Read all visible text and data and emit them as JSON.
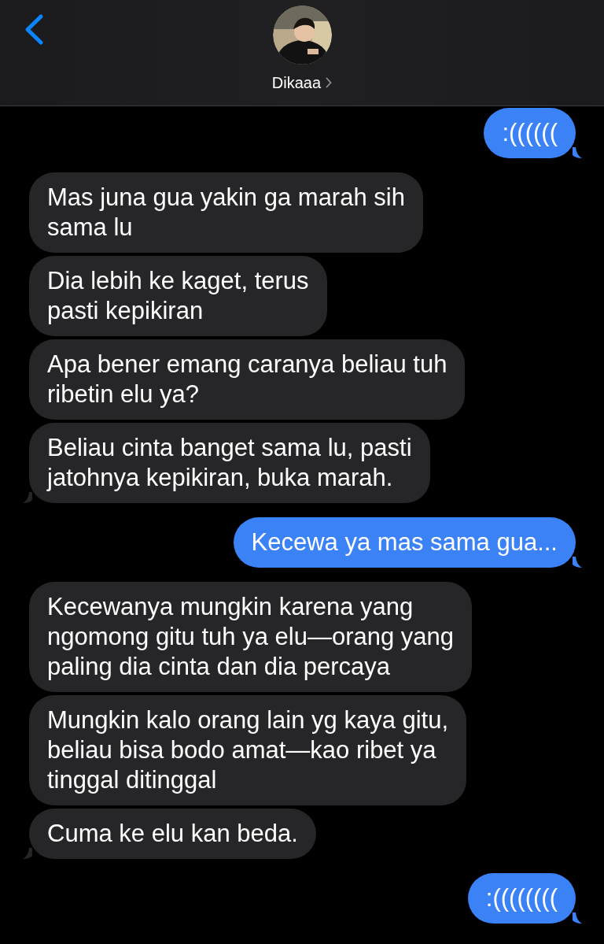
{
  "header": {
    "contact_name": "Dikaaa"
  },
  "messages": [
    {
      "kind": "sent",
      "text": ":((((((",
      "tail": true
    },
    {
      "kind": "received",
      "text": "Mas juna gua yakin ga marah sih\nsama lu",
      "tail": false
    },
    {
      "kind": "received",
      "text": "Dia lebih ke kaget, terus\npasti kepikiran",
      "tail": false
    },
    {
      "kind": "received",
      "text": "Apa bener emang caranya beliau tuh\nribetin elu ya?",
      "tail": false
    },
    {
      "kind": "received",
      "text": "Beliau cinta banget sama lu, pasti\njatohnya kepikiran, buka marah.",
      "tail": true
    },
    {
      "kind": "sent",
      "text": "Kecewa ya mas sama gua...",
      "tail": true
    },
    {
      "kind": "received",
      "text": "Kecewanya mungkin karena yang\nngomong gitu tuh ya elu—orang yang\npaling dia cinta dan dia percaya",
      "tail": false
    },
    {
      "kind": "received",
      "text": "Mungkin kalo orang lain yg kaya gitu,\nbeliau bisa bodo amat—kao ribet ya\ntinggal ditinggal",
      "tail": false
    },
    {
      "kind": "received",
      "text": "Cuma ke elu kan beda.",
      "tail": true
    },
    {
      "kind": "sent",
      "text": ":((((((((",
      "tail": true
    }
  ]
}
